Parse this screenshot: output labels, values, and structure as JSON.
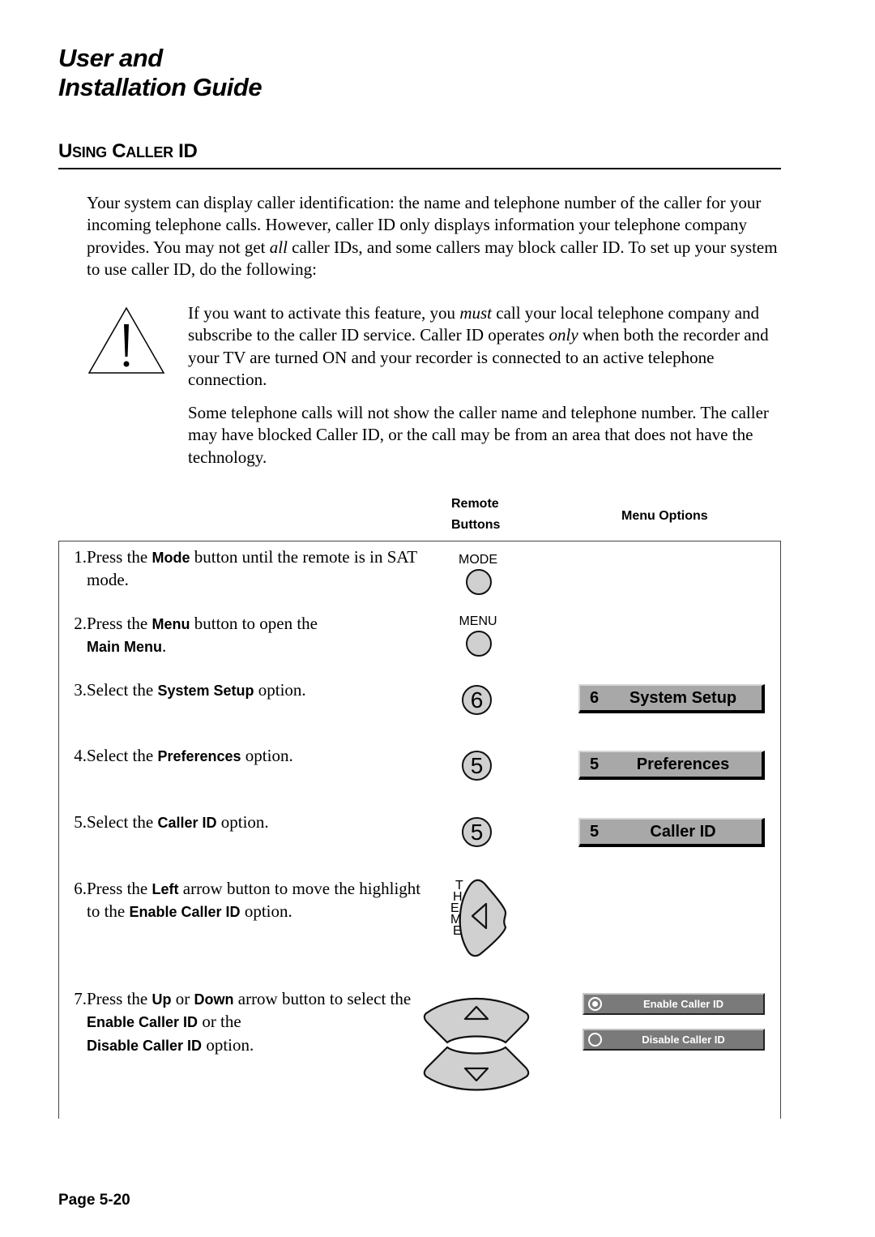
{
  "document": {
    "title_line1": "User and",
    "title_line2": "Installation Guide",
    "section_heading": {
      "first_initial": "U",
      "first_rest": "SING",
      "second_initial": "C",
      "second_rest": "ALLER",
      "last": "ID"
    },
    "intro": {
      "part1": "Your system can display caller identification:  the name and telephone number of the caller for your incoming telephone calls.  However, caller ID only displays information your telephone company provides.  You may not get ",
      "emph": "all",
      "part2": " caller IDs, and some callers may block caller ID.  To set up your system to use caller ID, do the following:"
    },
    "warning": {
      "icon": "warning-triangle-icon",
      "p1_a": "If you want to activate this feature, you ",
      "p1_emph1": "must",
      "p1_b": " call your local telephone company and subscribe to the caller ID service.  Caller ID operates ",
      "p1_emph2": "only",
      "p1_c": " when both the recorder and your TV are turned ON and your recorder is connected to an active telephone connection.",
      "p2": "Some telephone calls will not show the caller name and telephone number. The caller may have blocked Caller ID, or the call may be from an area that does not have the technology."
    },
    "columns": {
      "remote_line1": "Remote",
      "remote_line2": "Buttons",
      "menu_options": "Menu Options"
    },
    "steps": [
      {
        "num": "1.",
        "a": "Press the ",
        "b1": "Mode",
        "c": " button until the remote is in SAT mode."
      },
      {
        "num": "2.",
        "a": "Press the ",
        "b1": "Menu",
        "c": " button to open the ",
        "b2": "Main Menu",
        "d": "."
      },
      {
        "num": "3.",
        "a": "Select the ",
        "b1": "System Setup",
        "c": " option."
      },
      {
        "num": "4.",
        "a": "Select the ",
        "b1": "Preferences",
        "c": " option."
      },
      {
        "num": "5.",
        "a": "Select the ",
        "b1": "Caller ID",
        "c": " option."
      },
      {
        "num": "6.",
        "a": "Press the ",
        "b1": "Left",
        "c": " arrow button to move the highlight to the ",
        "b2": "Enable Caller ID",
        "d": " option."
      },
      {
        "num": "7.",
        "a": "Press the ",
        "b1": "Up",
        "c": " or ",
        "b2": "Down",
        "d": " arrow button to select the ",
        "b3": "Enable Caller ID",
        "e": " or the ",
        "b4": "Disable Caller ID",
        "f": " option."
      }
    ],
    "remote_buttons": {
      "mode_label": "MODE",
      "menu_label": "MENU",
      "digit_1": "6",
      "digit_2": "5",
      "digit_3": "5",
      "theme_letters": [
        "T",
        "H",
        "E",
        "M",
        "E"
      ],
      "left_icon": "left-arrow-icon",
      "up_icon": "up-arrow-icon",
      "down_icon": "down-arrow-icon"
    },
    "menu_options": [
      {
        "num": "6",
        "label": "System Setup"
      },
      {
        "num": "5",
        "label": "Preferences"
      },
      {
        "num": "5",
        "label": "Caller ID"
      }
    ],
    "radio_options": [
      {
        "label": "Enable Caller ID",
        "selected": true
      },
      {
        "label": "Disable Caller ID",
        "selected": false
      }
    ],
    "page_number": "Page 5-20"
  }
}
